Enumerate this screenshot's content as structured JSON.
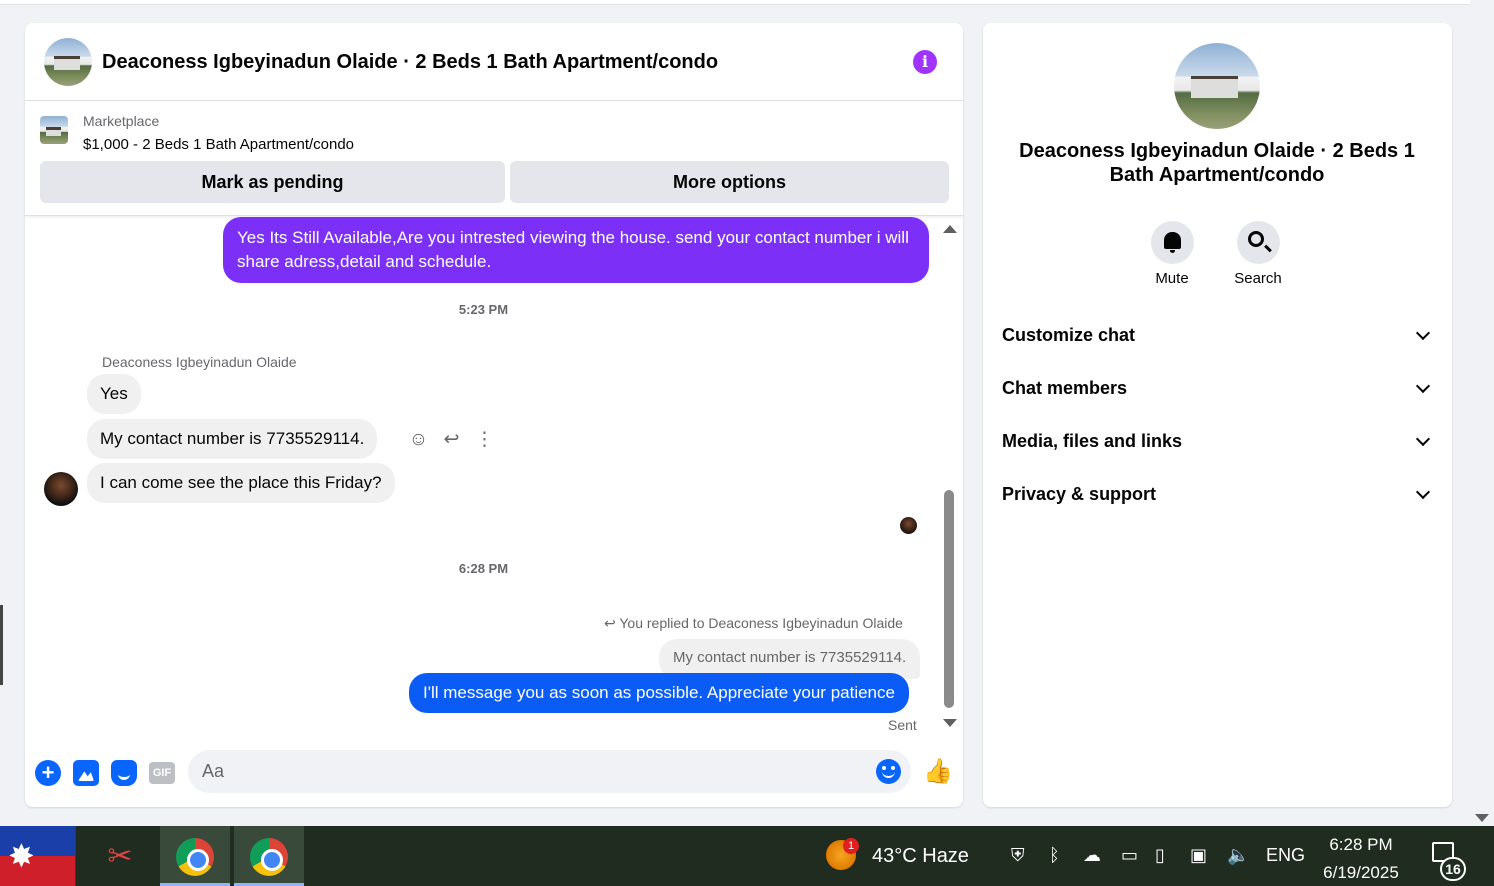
{
  "chat": {
    "title": "Deaconess Igbeyinadun Olaide · 2 Beds 1 Bath Apartment/condo",
    "marketplace_label": "Marketplace",
    "listing": "$1,000 - 2 Beds 1 Bath Apartment/condo",
    "mark_pending": "Mark as pending",
    "more_options": "More options",
    "messages": {
      "outgoing_1": "Yes Its Still Available,Are you intrested viewing the house. send your contact number i will share adress,detail and schedule.",
      "time_1": "5:23 PM",
      "sender_name": "Deaconess Igbeyinadun Olaide",
      "incoming_1": "Yes",
      "incoming_2": "My contact number is 7735529114.",
      "incoming_3": "I can come see the place this Friday?",
      "time_2": "6:28 PM",
      "reply_note": "You replied to Deaconess Igbeyinadun Olaide",
      "reply_quote": "My contact number is 7735529114.",
      "outgoing_2": "I'll message you as soon as possible. Appreciate your patience",
      "status": "Sent"
    },
    "composer": {
      "placeholder": "Aa",
      "gif_label": "GIF"
    }
  },
  "info_panel": {
    "title": "Deaconess Igbeyinadun Olaide · 2 Beds 1 Bath Apartment/condo",
    "mute_label": "Mute",
    "search_label": "Search",
    "sections": [
      "Customize chat",
      "Chat members",
      "Media, files and links",
      "Privacy & support"
    ]
  },
  "taskbar": {
    "weather_badge": "1",
    "weather": "43°C  Haze",
    "language": "ENG",
    "time": "6:28 PM",
    "date": "6/19/2025",
    "notification_count": "16"
  },
  "colors": {
    "accent_purple": "#7b2ff7",
    "accent_blue": "#0a5cf5",
    "messenger_blue": "#0866ff"
  }
}
